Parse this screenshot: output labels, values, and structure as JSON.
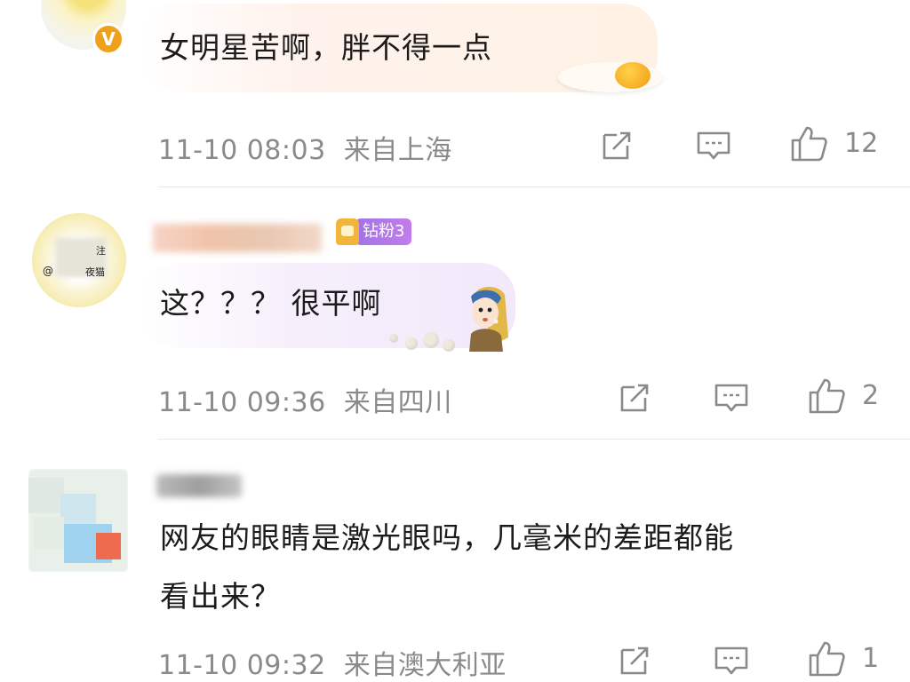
{
  "comments": [
    {
      "text": "女明星苦啊，胖不得一点",
      "time": "11-10 08:03",
      "location": "来自上海",
      "likes": "12",
      "badge_letter": "V"
    },
    {
      "text": "这？？？ 很平啊",
      "time": "11-10 09:36",
      "location": "来自四川",
      "likes": "2",
      "fan_badge": "钻粉3",
      "avatar_text": [
        "注",
        "@",
        "夜猫"
      ]
    },
    {
      "text_line1": "网友的眼睛是激光眼吗，几毫米的差距都能",
      "text_line2": "看出来？",
      "time": "11-10 09:32",
      "location": "来自澳大利亚",
      "likes": "1"
    }
  ],
  "icons": [
    "share-icon",
    "comment-icon",
    "like-icon"
  ],
  "colors": {
    "meta": "#8a8a8a",
    "text": "#1b1b1b",
    "fan_badge": "#b07ae8",
    "vip_badge": "#f0a11a"
  }
}
